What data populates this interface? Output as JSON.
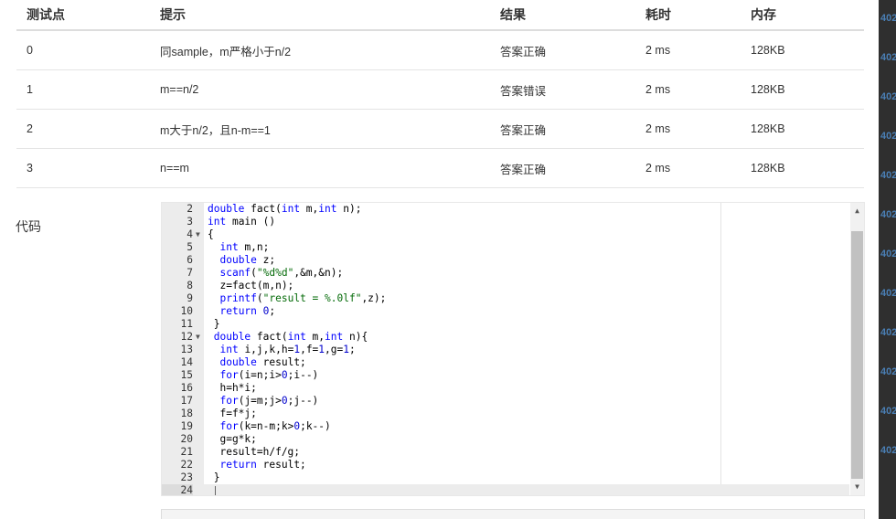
{
  "table": {
    "headers": [
      "测试点",
      "提示",
      "结果",
      "耗时",
      "内存"
    ],
    "rows": [
      {
        "id": "0",
        "hint": "同sample，m严格小于n/2",
        "result": "答案正确",
        "time": "2 ms",
        "memory": "128KB"
      },
      {
        "id": "1",
        "hint": "m==n/2",
        "result": "答案错误",
        "time": "2 ms",
        "memory": "128KB"
      },
      {
        "id": "2",
        "hint": "m大于n/2，且n-m==1",
        "result": "答案正确",
        "time": "2 ms",
        "memory": "128KB"
      },
      {
        "id": "3",
        "hint": "n==m",
        "result": "答案正确",
        "time": "2 ms",
        "memory": "128KB"
      }
    ]
  },
  "code_label": "代码",
  "editor": {
    "lines": [
      {
        "n": "2",
        "code": "double fact(int m,int n);"
      },
      {
        "n": "3",
        "code": "int main ()"
      },
      {
        "n": "4",
        "code": "{"
      },
      {
        "n": "5",
        "code": "  int m,n;"
      },
      {
        "n": "6",
        "code": "  double z;"
      },
      {
        "n": "7",
        "code": "  scanf(\"%d%d\",&m,&n);"
      },
      {
        "n": "8",
        "code": "  z=fact(m,n);"
      },
      {
        "n": "9",
        "code": "  printf(\"result = %.0lf\",z);"
      },
      {
        "n": "10",
        "code": "  return 0;"
      },
      {
        "n": "11",
        "code": " }"
      },
      {
        "n": "12",
        "code": " double fact(int m,int n){"
      },
      {
        "n": "13",
        "code": "  int i,j,k,h=1,f=1,g=1;"
      },
      {
        "n": "14",
        "code": "  double result;"
      },
      {
        "n": "15",
        "code": "  for(i=n;i>0;i--)"
      },
      {
        "n": "16",
        "code": "  h=h*i;"
      },
      {
        "n": "17",
        "code": "  for(j=m;j>0;j--)"
      },
      {
        "n": "18",
        "code": "  f=f*j;"
      },
      {
        "n": "19",
        "code": "  for(k=n-m;k>0;k--)"
      },
      {
        "n": "20",
        "code": "  g=g*k;"
      },
      {
        "n": "21",
        "code": "  result=h/f/g;"
      },
      {
        "n": "22",
        "code": "  return result;"
      },
      {
        "n": "23",
        "code": " }"
      },
      {
        "n": "24",
        "code": ""
      }
    ],
    "fold_lines": [
      "4",
      "12"
    ],
    "active_line": "24"
  },
  "background_ticks": [
    "402",
    "402",
    "402",
    "402",
    "402",
    "402",
    "402",
    "402",
    "402",
    "402",
    "402",
    "402"
  ],
  "colors": {
    "accepted": "#d9534f",
    "wrong": "#3c9a3c",
    "keyword": "#0000ff",
    "string": "#036a07"
  },
  "icons": {
    "fold": "triangle-down-icon",
    "scroll_up": "arrow-up-icon",
    "scroll_down": "arrow-down-icon"
  }
}
